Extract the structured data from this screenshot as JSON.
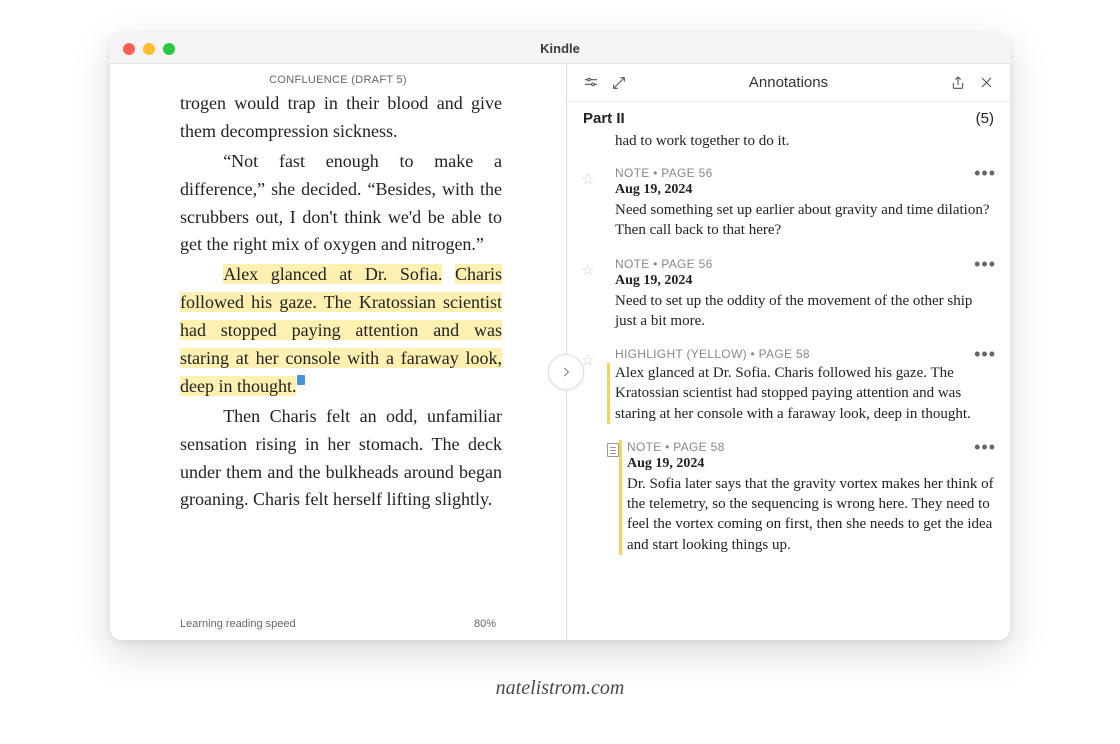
{
  "window": {
    "title": "Kindle"
  },
  "document": {
    "title": "CONFLUENCE (DRAFT 5)",
    "para1": "trogen would trap in their blood and give them decompression sickness.",
    "para2": "“Not fast enough to make a difference,” she decided. “Besides, with the scrubbers out, I don't think we'd be able to get the right mix of oxygen and nitrogen.”",
    "hl_start": "Alex glanced at Dr. Sofia.",
    "hl_rest": "Charis followed his gaze. The Kratossian scientist had stopped paying attention and was staring at her console with a faraway look, deep in thought.",
    "para4": "Then Charis felt an odd, unfamiliar sensation rising in her stomach. The deck under them and the bulkheads around began groaning. Charis felt herself lifting slightly.",
    "footer_left": "Learning reading speed",
    "footer_right": "80%"
  },
  "panel": {
    "title": "Annotations",
    "section": "Part II",
    "count": "(5)",
    "fragment": "had to work together to do it."
  },
  "annotations": [
    {
      "meta": "NOTE • PAGE 56",
      "date": "Aug 19, 2024",
      "body": "Need something set up earlier about gravity and time dilation? Then call back to that here?"
    },
    {
      "meta": "NOTE • PAGE 56",
      "date": "Aug 19, 2024",
      "body": "Need to set up the oddity of the movement of the other ship just a bit more."
    },
    {
      "meta": "HIGHLIGHT (YELLOW) • PAGE 58",
      "body": "Alex glanced at Dr. Sofia. Charis followed his gaze. The Kratossian scientist had stopped paying attention and was staring at her console with a faraway look, deep in thought."
    },
    {
      "meta": "NOTE • PAGE 58",
      "date": "Aug 19, 2024",
      "body": "Dr. Sofia later says that the gravity vortex makes her think of the telemetry, so the sequencing is wrong here. They need to feel the vortex coming on first, then she needs to get the idea and start looking things up."
    }
  ],
  "watermark": "natelistrom.com"
}
